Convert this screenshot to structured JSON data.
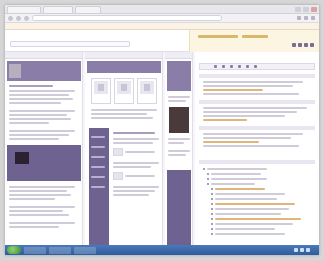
{
  "window": {
    "tabs": [
      "",
      "",
      ""
    ]
  },
  "toolbar": {
    "url": ""
  },
  "bookmarks": [
    "",
    "",
    "",
    ""
  ],
  "header": {
    "title": ""
  },
  "columns": {
    "left_heading": "",
    "middle_heading": "",
    "right_heading": ""
  },
  "right_panel": {
    "title": ""
  },
  "taskbar": {
    "items": [
      "",
      "",
      ""
    ],
    "clock": ""
  },
  "colors": {
    "accent_purple": "#8a7ea8",
    "accent_purple_dark": "#6e6290",
    "bookmark_bg": "#fbf3e6",
    "taskbar_blue": "#2f5c9e"
  },
  "icons": [
    "back-icon",
    "forward-icon",
    "reload-icon",
    "home-icon",
    "windows-start-icon"
  ]
}
